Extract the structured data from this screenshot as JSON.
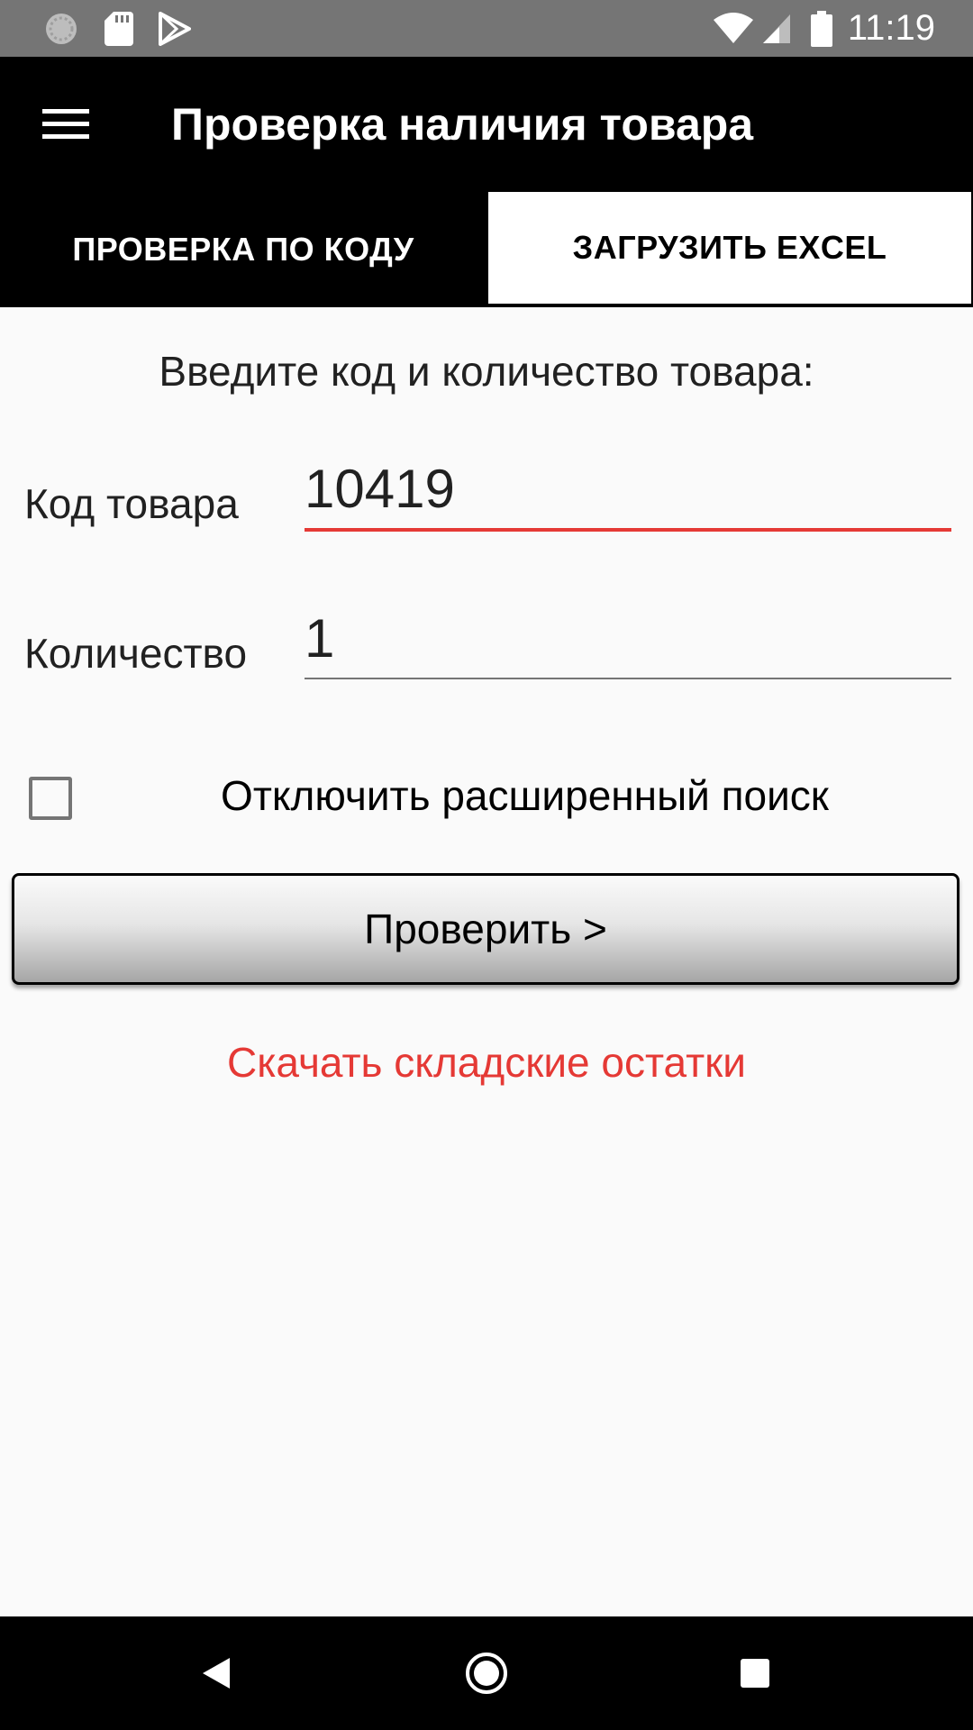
{
  "status_bar": {
    "time": "11:19",
    "left_icons": [
      "sync-icon",
      "sd-card-icon",
      "play-store-icon"
    ],
    "right_icons": [
      "wifi-icon",
      "cellular-signal-icon",
      "battery-icon"
    ]
  },
  "app_bar": {
    "menu_icon": "menu-icon",
    "title": "Проверка наличия товара"
  },
  "tabs": [
    {
      "label": "ПРОВЕРКА ПО КОДУ",
      "selected": false
    },
    {
      "label": "ЗАГРУЗИТЬ EXCEL",
      "selected": true
    }
  ],
  "form": {
    "instruction": "Введите код и количество товара:",
    "code_label": "Код товара",
    "code_value": "10419",
    "quantity_label": "Количество",
    "quantity_value": "1",
    "checkbox_label": "Отключить расширенный поиск",
    "checkbox_checked": false,
    "check_button_label": "Проверить >",
    "download_link": "Скачать складские остатки"
  },
  "colors": {
    "accent": "#e53935",
    "app_bar": "#000000",
    "status_bar": "#757575",
    "background": "#fafafa"
  },
  "nav_bar": {
    "buttons": [
      "back-icon",
      "home-icon",
      "recents-icon"
    ]
  }
}
